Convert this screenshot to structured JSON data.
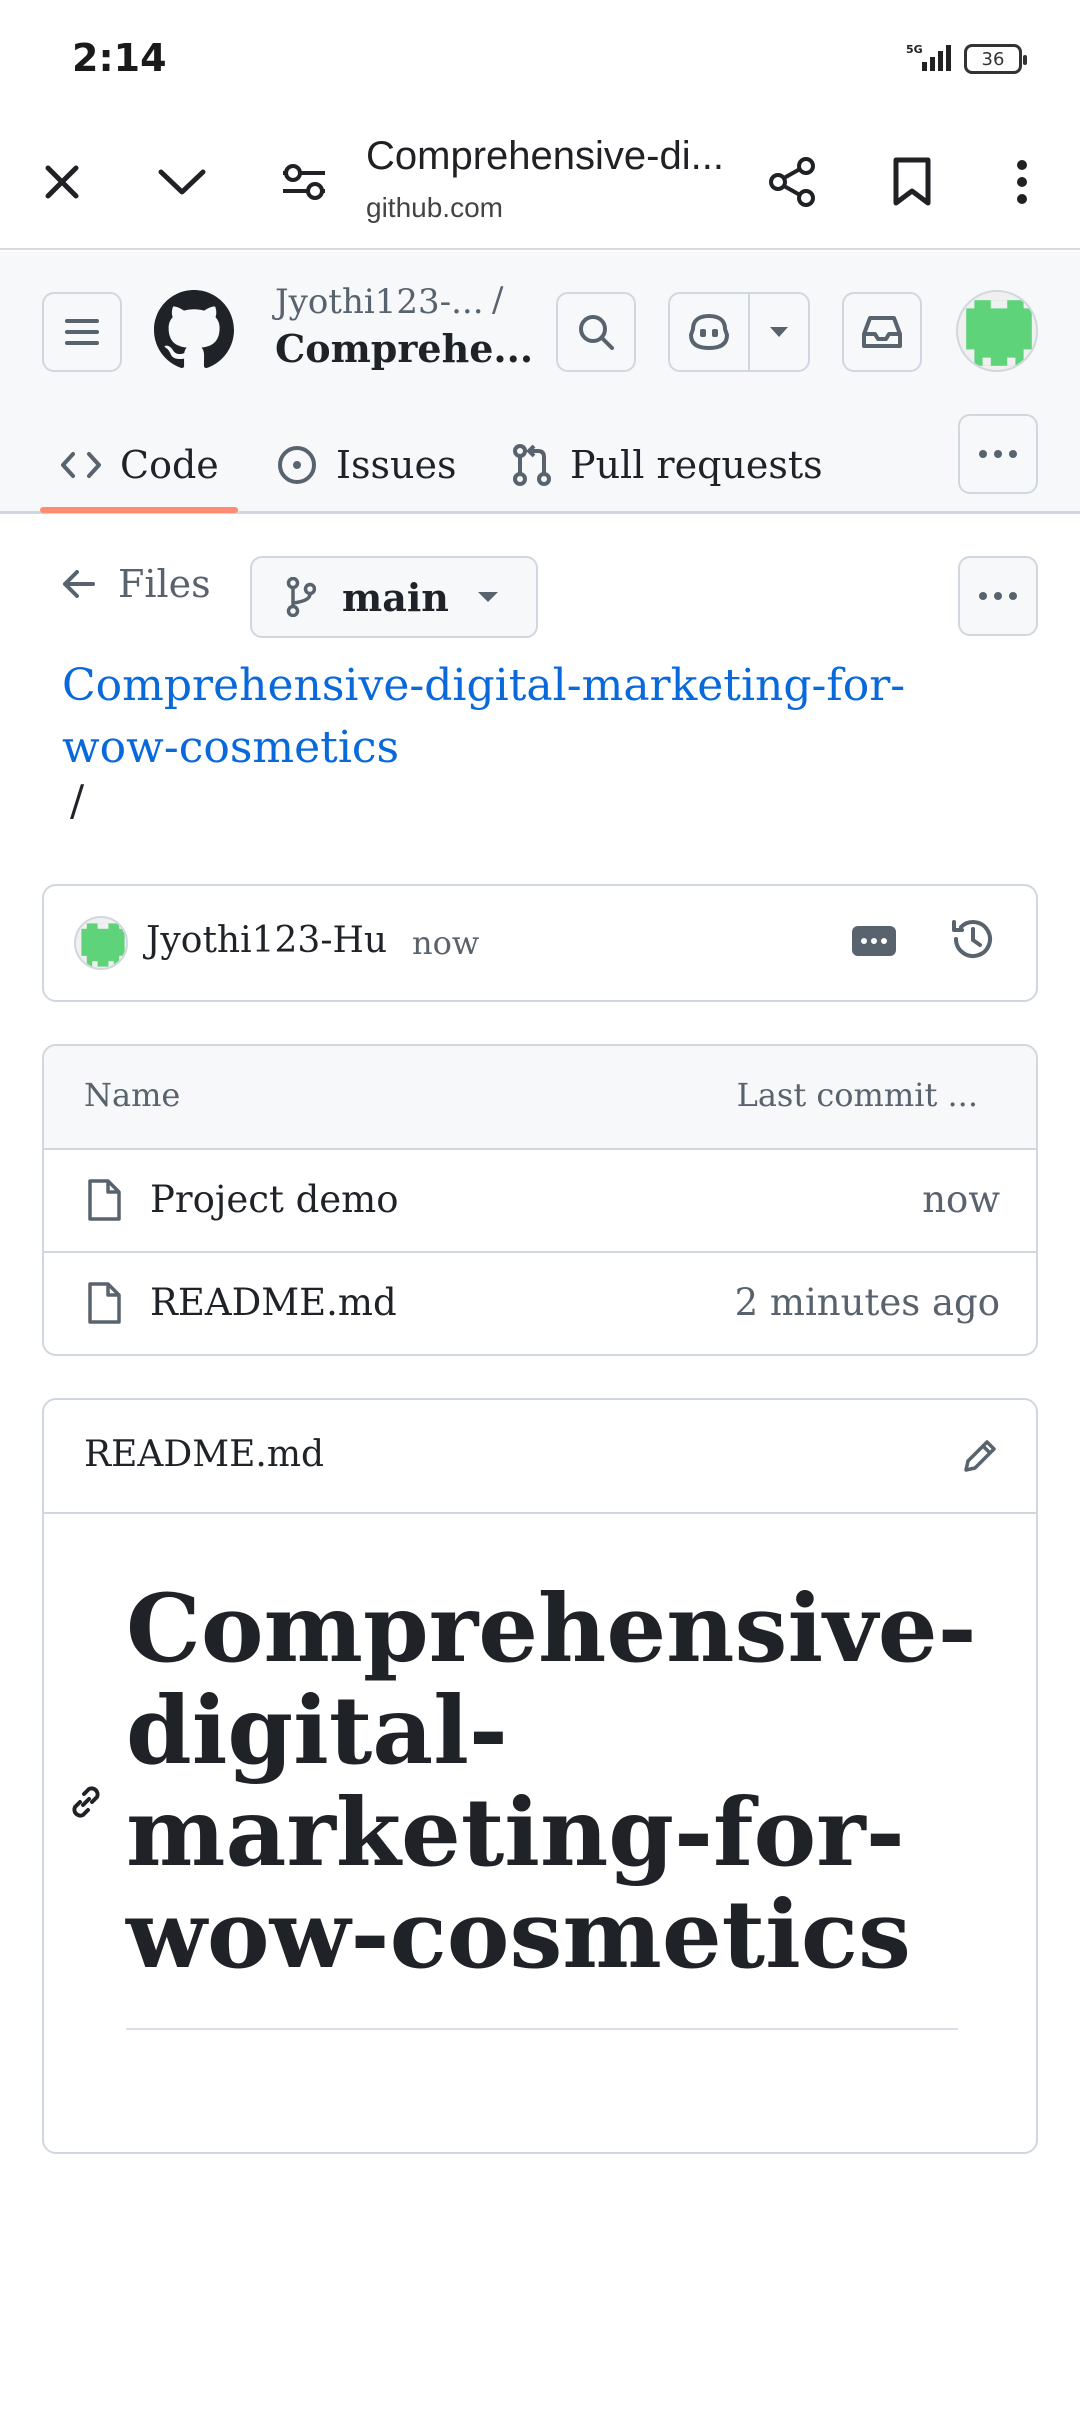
{
  "status_bar": {
    "time": "2:14",
    "battery": "36",
    "network": "5G"
  },
  "browser": {
    "page_title": "Comprehensive-di...",
    "domain": "github.com"
  },
  "header": {
    "repo_owner": "Jyothi123-...",
    "repo_separator": "/",
    "repo_name": "Comprehe..."
  },
  "nav": {
    "tabs": [
      {
        "label": "Code",
        "active": true
      },
      {
        "label": "Issues"
      },
      {
        "label": "Pull requests"
      }
    ]
  },
  "files_bar": {
    "files_label": "Files",
    "branch": "main"
  },
  "breadcrumb": {
    "path": "Comprehensive-digital-marketing-for-wow-cosmetics",
    "separator": "/"
  },
  "commit": {
    "user": "Jyothi123-Hu",
    "time": "now"
  },
  "file_table": {
    "headers": {
      "name": "Name",
      "last_commit": "Last commit ..."
    },
    "rows": [
      {
        "name": "Project demo",
        "time": "now"
      },
      {
        "name": "README.md",
        "time": "2 minutes ago"
      }
    ]
  },
  "readme": {
    "title": "README.md",
    "heading": "Comprehensive-digital-marketing-for-wow-cosmetics"
  },
  "colors": {
    "link": "#0969da",
    "tab_underline": "#fd8c73",
    "avatar_green": "#5fd37a"
  }
}
